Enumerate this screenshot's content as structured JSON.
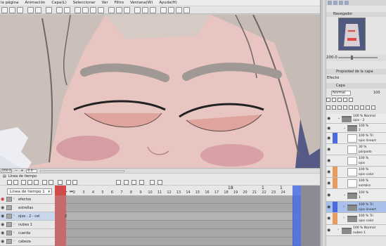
{
  "menu": [
    "la página",
    "Animación",
    "Capa(L)",
    "Seleccionar",
    "Ver",
    "Filtro",
    "Ventana(W)",
    "Ayuda(H)"
  ],
  "status": {
    "zoom": "200.0",
    "angle": "0.0"
  },
  "timeline": {
    "panel_title": "Línea de tiempo",
    "select_label": "Línea de tiempo 1",
    "frame_in": "1",
    "frame_out": "1",
    "frame_total": "24",
    "current_frame": "18",
    "ruler": [
      "1",
      "2",
      "3",
      "4",
      "5",
      "6",
      "7",
      "8",
      "9",
      "10",
      "11",
      "12",
      "13",
      "14",
      "15",
      "16",
      "17",
      "18",
      "19",
      "20",
      "21",
      "22",
      "23",
      "24"
    ],
    "rows": [
      {
        "label": "efectos",
        "mark": ""
      },
      {
        "label": "estrellas",
        "mark": ""
      },
      {
        "label": "ojos - 2 - cel",
        "mark": "2"
      },
      {
        "label": "nubes 1",
        "mark": ""
      },
      {
        "label": "cuerda",
        "mark": ""
      },
      {
        "label": "cabeza",
        "mark": ""
      }
    ],
    "toolbar_number": "18"
  },
  "navigator": {
    "title": "Navegador",
    "zoom": "200.0",
    "angle": "0.0"
  },
  "layer_property": {
    "title": "Propiedad de la capa"
  },
  "effects_label": "Efecto",
  "layer_panel": {
    "tab": "Capa",
    "blend_mode": "Normal",
    "opacity": "100"
  },
  "layers": [
    {
      "line1": "100 % Normal",
      "line2": "ojos - 2",
      "type": "folder"
    },
    {
      "line1": "100 %",
      "line2": "2",
      "type": "folder"
    },
    {
      "line1": "100 % Tri",
      "line2": "ojos lineart",
      "type": "layer"
    },
    {
      "line1": "30 %",
      "line2": "párpado",
      "type": "layer"
    },
    {
      "line1": "100 %",
      "line2": "ojos",
      "type": "layer"
    },
    {
      "line1": "100 %",
      "line2": "ojos color",
      "type": "layer"
    },
    {
      "line1": "100 %",
      "line2": "sombra",
      "type": "layer"
    },
    {
      "line1": "100 %",
      "line2": "1",
      "type": "folder"
    },
    {
      "line1": "100 % Tri",
      "line2": "ojos lineart",
      "type": "layer"
    },
    {
      "line1": "100 % Tri",
      "line2": "ojos color",
      "type": "layer"
    },
    {
      "line1": "100 % Normal",
      "line2": "nubes 1",
      "type": "folder"
    }
  ],
  "colors": {
    "canvas_bg": "#555b86",
    "skin": "#e9c5c1",
    "hair": "#c9bdb9",
    "timeline_red": "#c66b6b",
    "timeline_blue": "#4b6adf",
    "layer_selected": "#a9c1ea"
  }
}
